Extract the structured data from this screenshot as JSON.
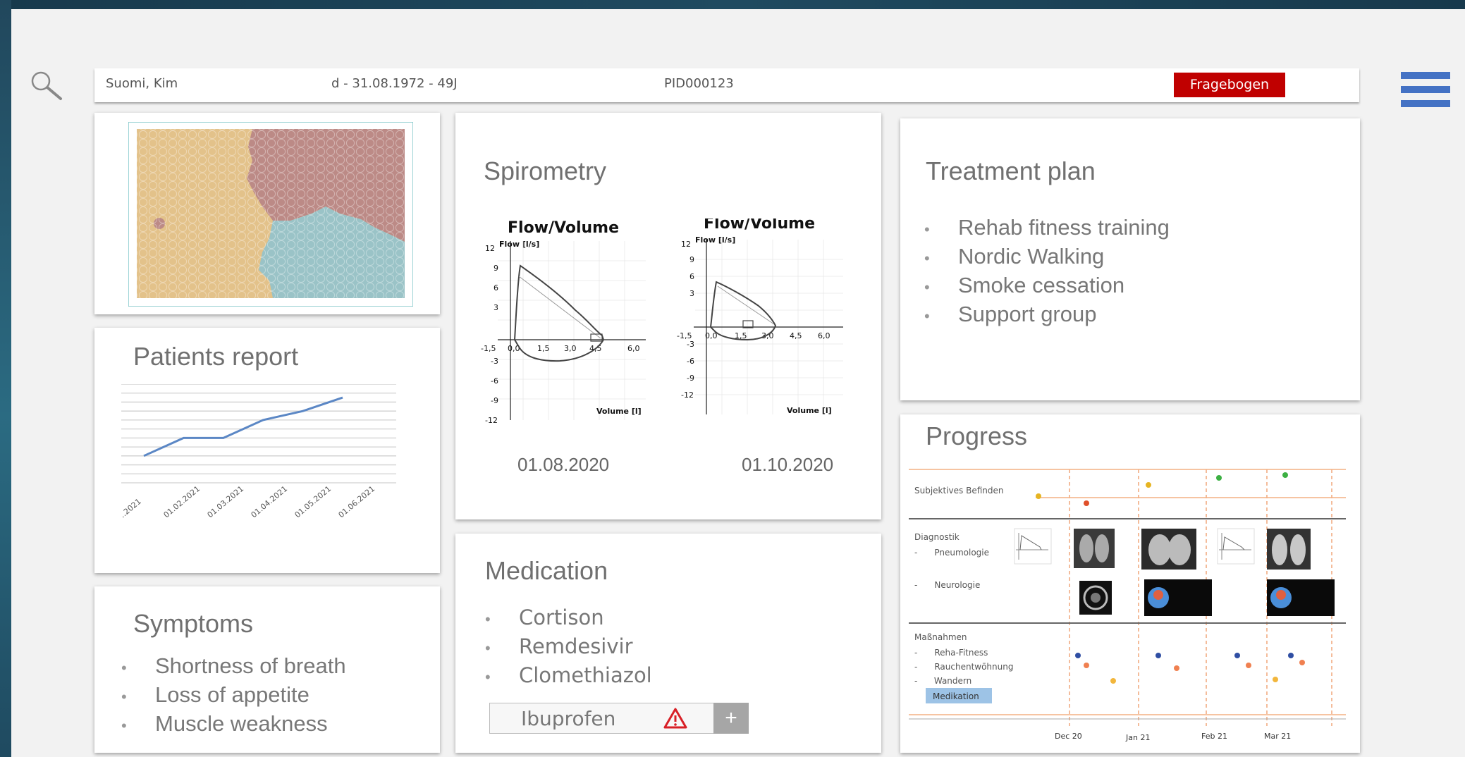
{
  "header": {
    "patient_name": "Suomi, Kim",
    "birth_info": "d - 31.08.1972 - 49J",
    "patient_id": "PID000123",
    "questionnaire_button": "Fragebogen"
  },
  "patients_report": {
    "title": "Patients report",
    "x_labels": [
      "..2021",
      "01.02.2021",
      "01.03.2021",
      "01.04.2021",
      "01.05.2021",
      "01.06.2021"
    ],
    "chart_data": {
      "type": "line",
      "categories": [
        "..2021",
        "01.02.2021",
        "01.03.2021",
        "01.04.2021",
        "01.05.2021",
        "01.06.2021"
      ],
      "values": [
        3,
        5,
        5,
        7,
        8,
        9.5
      ],
      "ylim": [
        0,
        11
      ],
      "grid": true
    }
  },
  "spirometry": {
    "title": "Spirometry",
    "chart1": {
      "title": "Flow/Volume",
      "ylabel": "Flow [l/s]",
      "xlabel": "Volume [l]",
      "date": "01.08.2020",
      "xticks": [
        "-1,5",
        "0,0",
        "1,5",
        "3,0",
        "4,5",
        "6,0"
      ],
      "yticks": [
        "12",
        "9",
        "6",
        "3",
        "-3",
        "-6",
        "-9",
        "-12"
      ]
    },
    "chart2": {
      "title": "Flow/Volume",
      "ylabel": "Flow [l/s]",
      "xlabel": "Volume [l]",
      "date": "01.10.2020",
      "xticks": [
        "-1,5",
        "0,0",
        "1,5",
        "3,0",
        "4,5",
        "6,0"
      ],
      "yticks": [
        "12",
        "9",
        "6",
        "3",
        "-3",
        "-6",
        "-9",
        "-12"
      ]
    }
  },
  "treatment_plan": {
    "title": "Treatment plan",
    "items": [
      "Rehab fitness training",
      "Nordic Walking",
      "Smoke cessation",
      "Support group"
    ]
  },
  "progress": {
    "title": "Progress",
    "rows": {
      "subjective": "Subjektives Befinden",
      "diagnostics": "Diagnostik",
      "pneumo": "Pneumologie",
      "neuro": "Neurologie",
      "measures": "Maßnahmen",
      "rehab": "Reha-Fitness",
      "smoking": "Rauchentwöhnung",
      "walking": "Wandern"
    },
    "medication_badge": "Medikation",
    "x_labels": [
      "Dec 20",
      "Jan 21",
      "Feb 21",
      "Mar 21"
    ]
  },
  "symptoms": {
    "title": "Symptoms",
    "items": [
      "Shortness of breath",
      "Loss of appetite",
      "Muscle weakness"
    ]
  },
  "medication": {
    "title": "Medication",
    "items": [
      "Cortison",
      "Remdesivir",
      "Clomethiazol"
    ],
    "new_entry": "Ibuprofen",
    "warning_icon": "warning-icon",
    "add_icon": "plus-icon"
  },
  "colors": {
    "accent_red": "#c00000",
    "menu_blue": "#4472c4",
    "line_blue": "#5b87c5",
    "map_tan": "#e3c28a",
    "map_rose": "#bc8a86",
    "map_teal": "#9ac3c7"
  }
}
